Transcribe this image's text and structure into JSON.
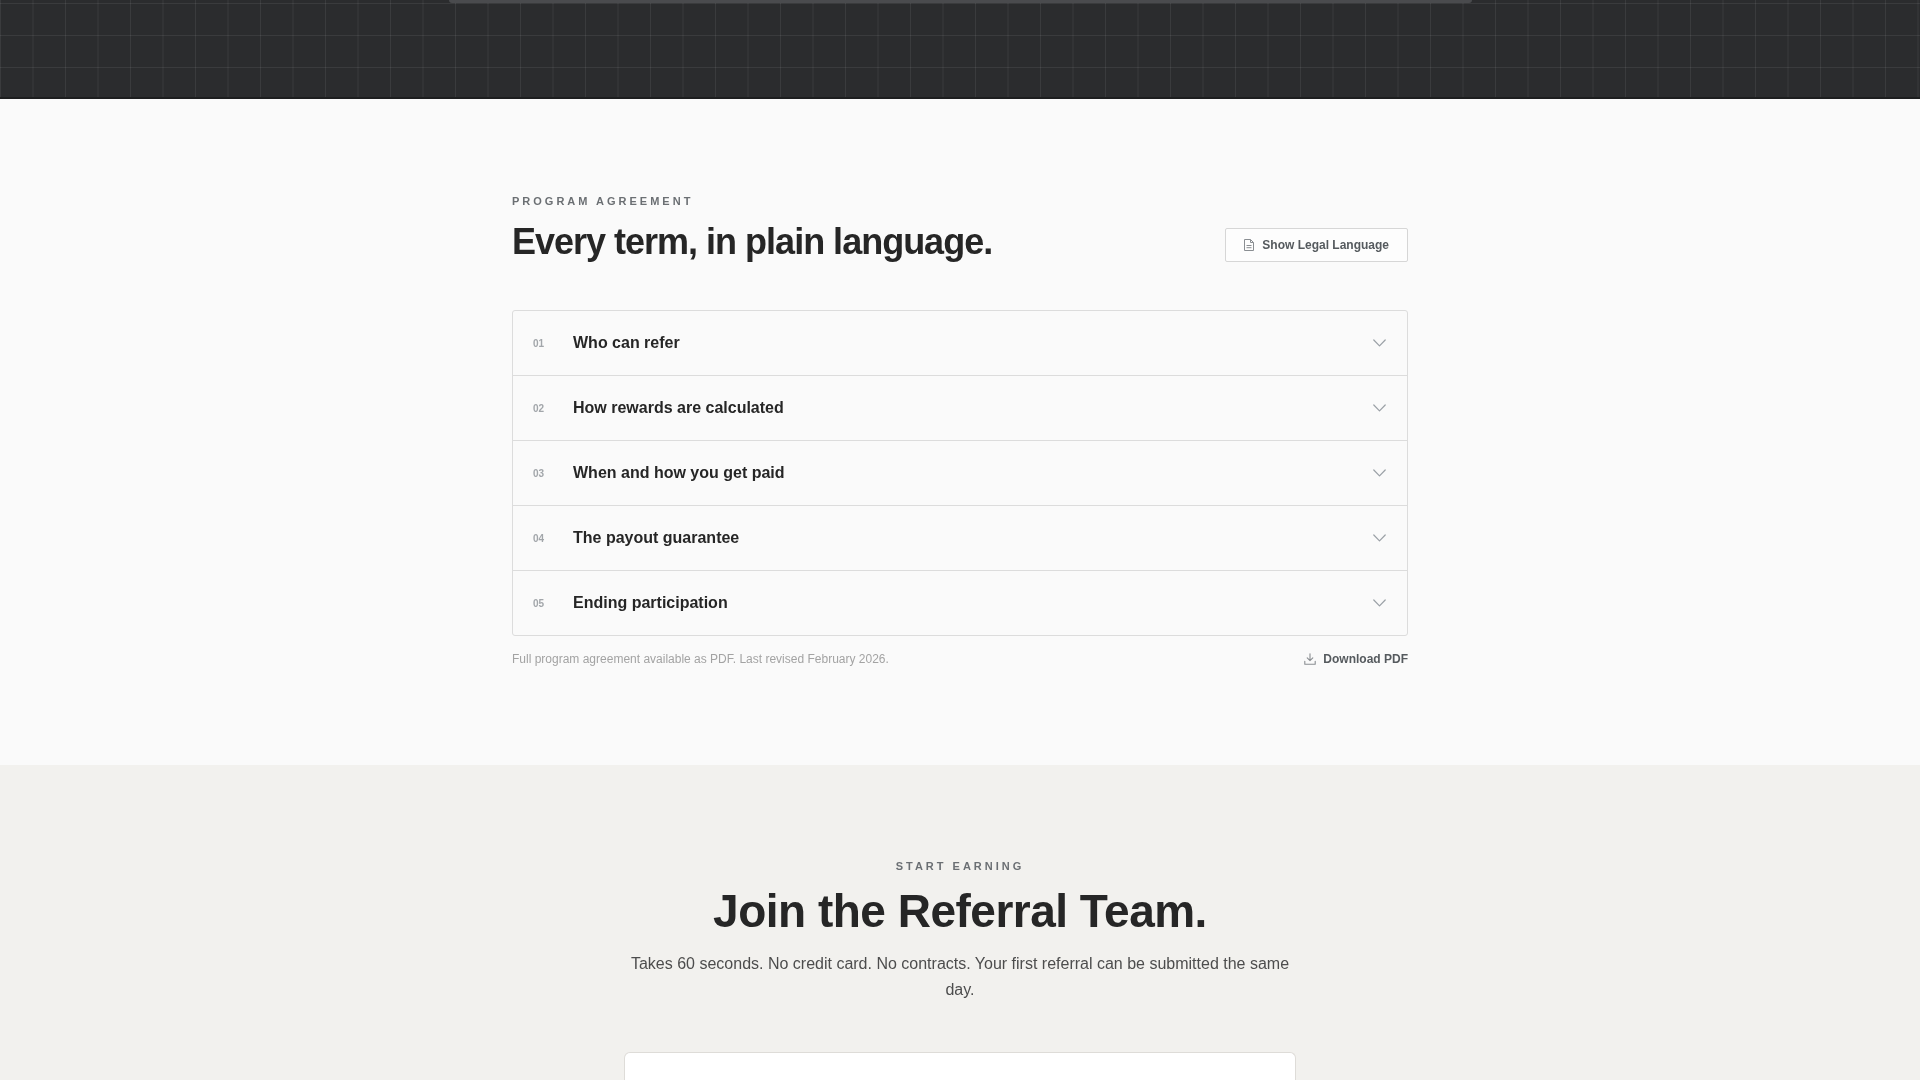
{
  "agreement": {
    "eyebrow": "PROGRAM AGREEMENT",
    "title": "Every term, in plain language.",
    "legal_button": {
      "label": "Show Legal Language"
    },
    "terms": [
      {
        "number": "01",
        "title": "Who can refer",
        "expanded": false
      },
      {
        "number": "02",
        "title": "How rewards are calculated",
        "expanded": false
      },
      {
        "number": "03",
        "title": "When and how you get paid",
        "expanded": false
      },
      {
        "number": "04",
        "title": "The payout guarantee",
        "expanded": false
      },
      {
        "number": "05",
        "title": "Ending participation",
        "expanded": false
      }
    ],
    "footnote": "Full program agreement available as PDF. Last revised February 2026.",
    "download_link": {
      "label": "Download PDF"
    }
  },
  "signup": {
    "eyebrow": "START EARNING",
    "title": "Join the Referral Team.",
    "description": "Takes 60 seconds. No credit card. No contracts. Your first referral can be submitted the same day."
  }
}
